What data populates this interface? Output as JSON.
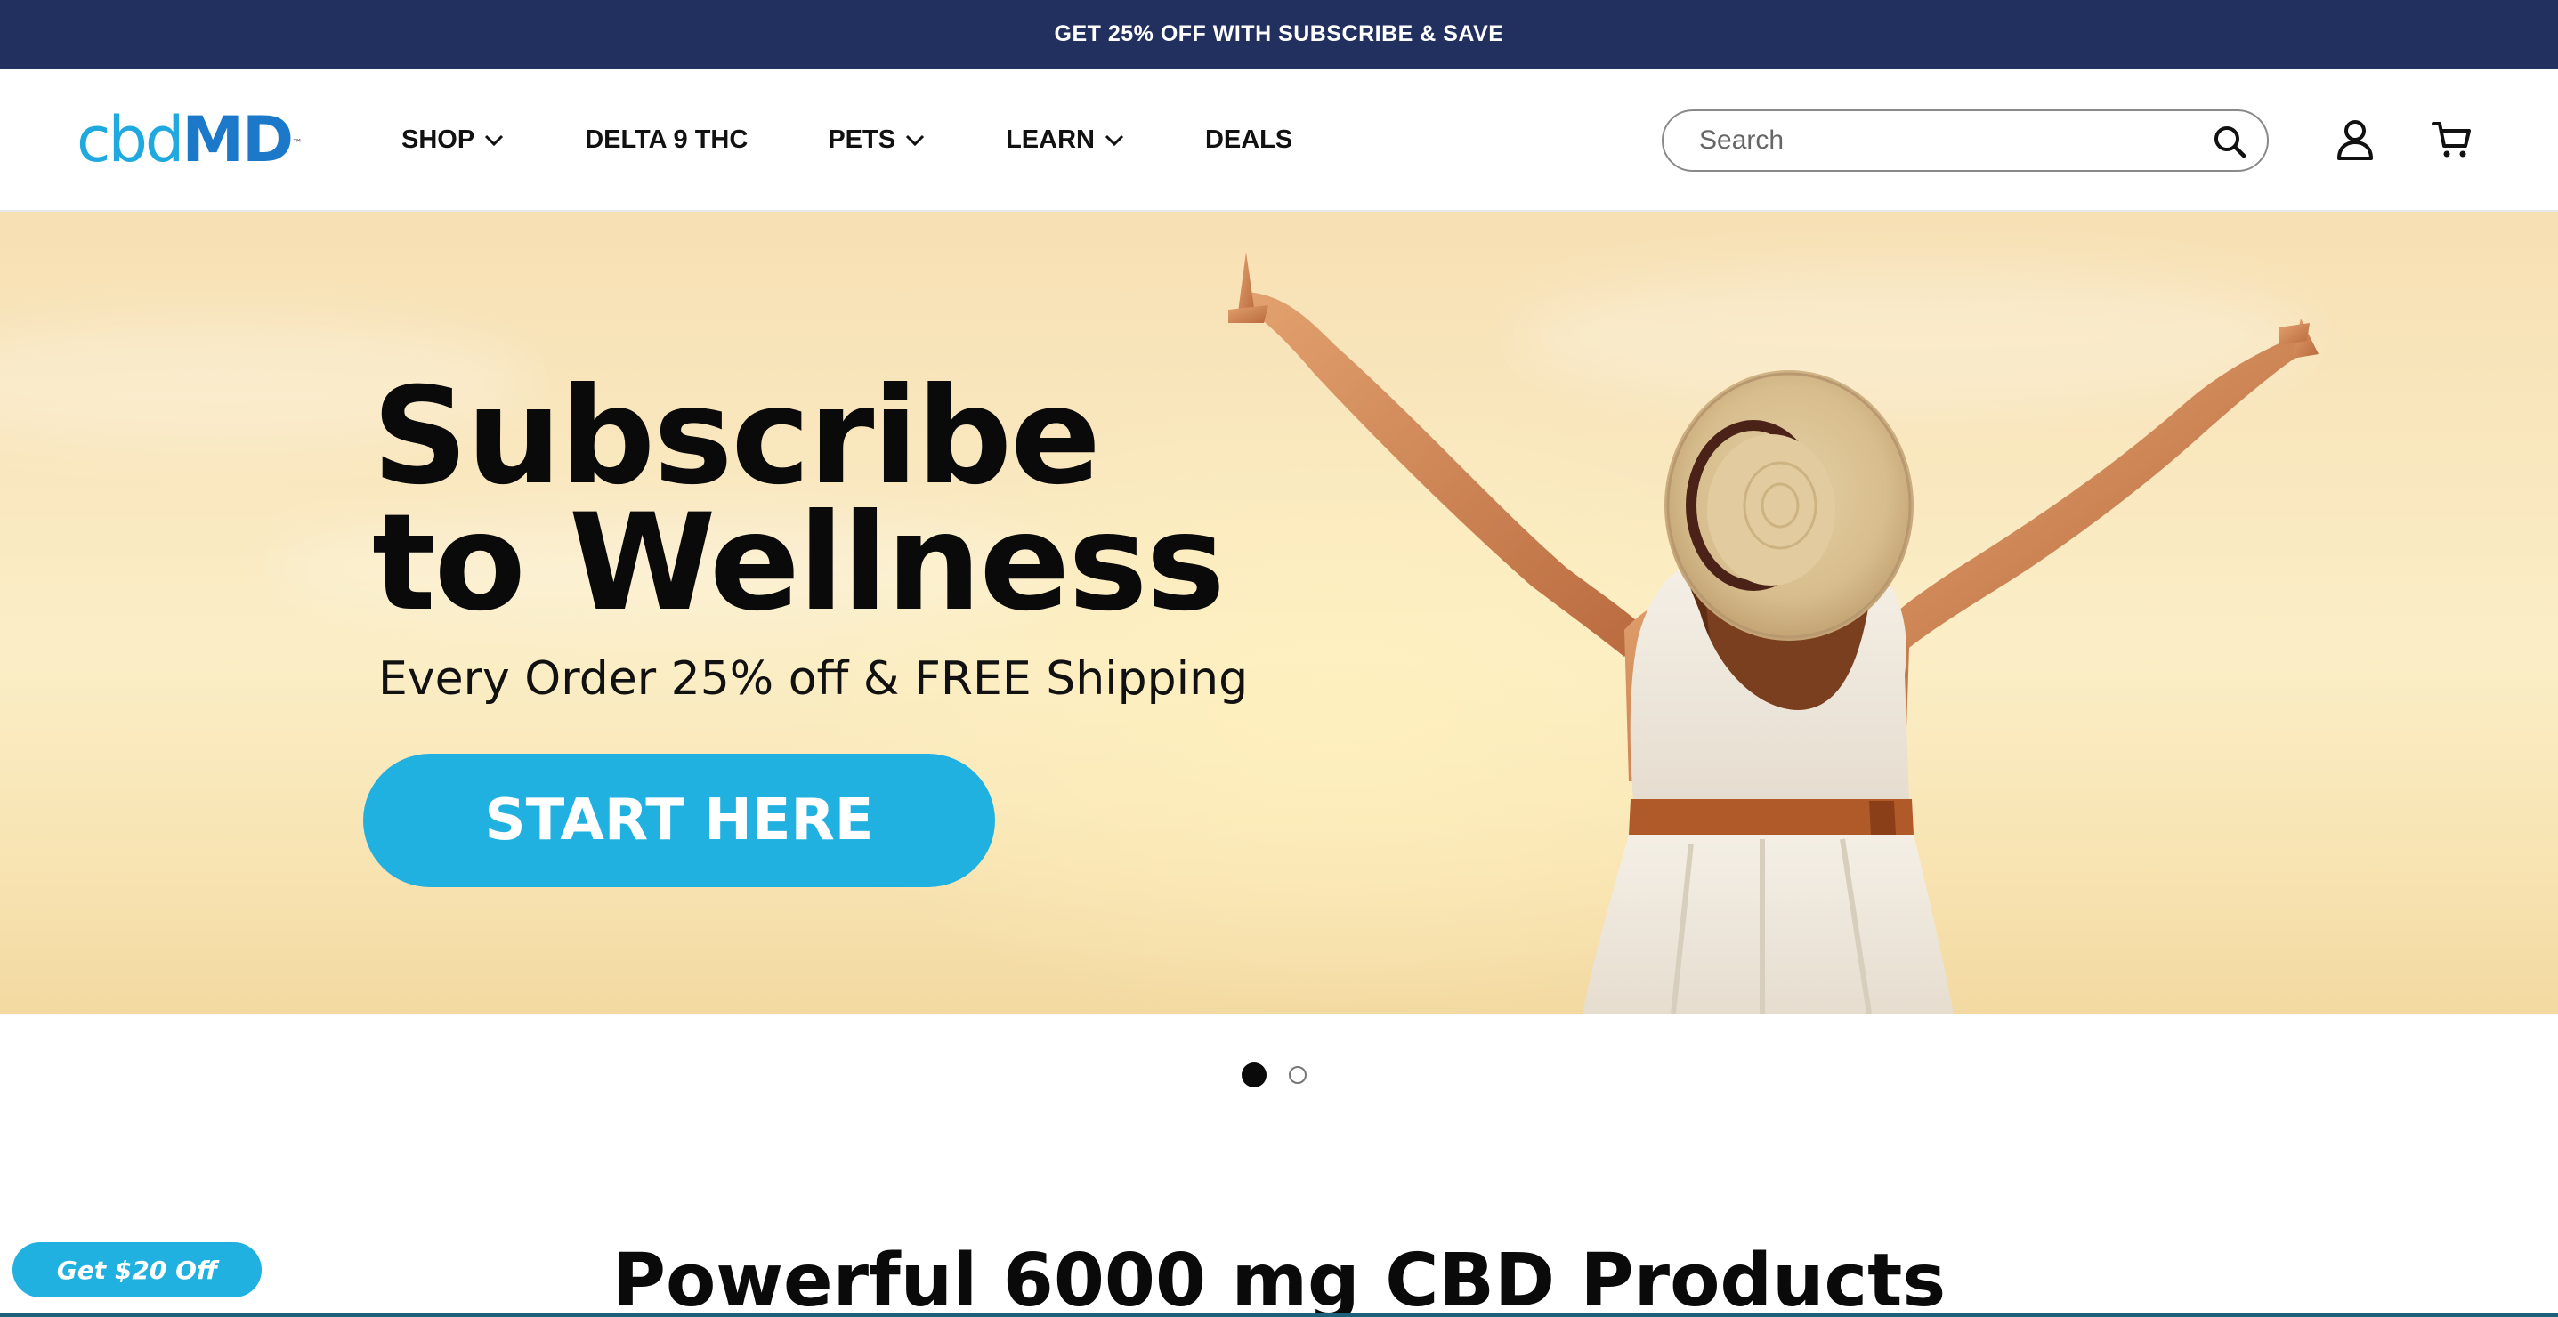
{
  "announcement": {
    "text": "GET 25% OFF WITH SUBSCRIBE & SAVE"
  },
  "header": {
    "logo": {
      "text_light": "cbd",
      "text_bold": "MD",
      "trademark": "™"
    },
    "nav": [
      {
        "label": "SHOP",
        "has_dropdown": true
      },
      {
        "label": "DELTA 9 THC",
        "has_dropdown": false
      },
      {
        "label": "PETS",
        "has_dropdown": true
      },
      {
        "label": "LEARN",
        "has_dropdown": true
      },
      {
        "label": "DEALS",
        "has_dropdown": false
      }
    ],
    "search": {
      "placeholder": "Search",
      "icon": "search-icon"
    },
    "account_icon": "user-icon",
    "cart_icon": "cart-icon"
  },
  "hero": {
    "title_line1": "Subscribe",
    "title_line2": "to Wellness",
    "subtitle": "Every Order 25% off & FREE Shipping",
    "cta_label": "START HERE"
  },
  "slider": {
    "slide_count": 2,
    "active_index": 0
  },
  "section": {
    "heading": "Powerful 6000 mg CBD Products"
  },
  "promo": {
    "label": "Get $20 Off"
  },
  "colors": {
    "announcement_bg": "#223060",
    "accent_blue": "#21b1e0",
    "logo_light": "#1fa9de",
    "logo_bold": "#1c78c9"
  }
}
